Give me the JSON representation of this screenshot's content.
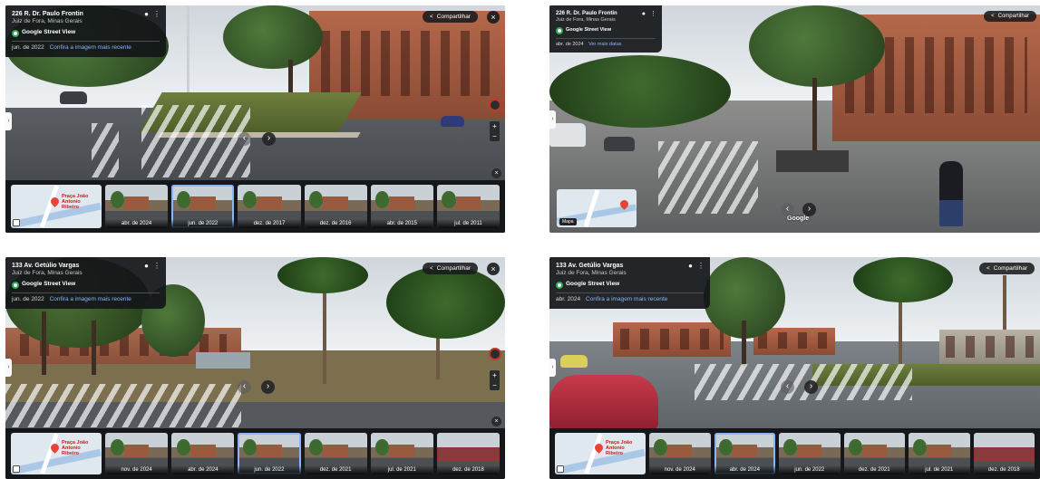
{
  "accent": "#8ab4f8",
  "panels": [
    {
      "address": "226 R. Dr. Paulo Frontin",
      "city": "Juiz de Fora, Minas Gerais",
      "source": "Google Street View",
      "capture_date": "jun. de 2022",
      "date_link": "Confira a imagem mais recente",
      "share_label": "Compartilhar",
      "map_label": "Praça João Antonio Ribeiro",
      "icons": [
        "pin-icon",
        "more-icon",
        "share-icon",
        "close-icon"
      ],
      "thumbs": [
        "abr. de 2024",
        "jun. de 2022",
        "dez. de 2017",
        "dez. de 2016",
        "abr. de 2015",
        "jul. de 2011"
      ],
      "selected_thumb": "jun. de 2022"
    },
    {
      "address": "226 R. Dr. Paulo Frontin",
      "city": "Juiz de Fora, Minas Gerais",
      "source": "Google Street View",
      "capture_date": "abr. de 2024",
      "date_link": "Ver mais datas",
      "share_label": "Compartilhar",
      "watermark": "Google",
      "map_button": "Mapa"
    },
    {
      "address": "133 Av. Getúlio Vargas",
      "city": "Juiz de Fora, Minas Gerais",
      "source": "Google Street View",
      "capture_date": "jun. de 2022",
      "date_link": "Confira a imagem mais recente",
      "share_label": "Compartilhar",
      "map_label": "Praça João Antonio Ribeiro",
      "thumbs": [
        "nov. de 2024",
        "abr. de 2024",
        "jun. de 2022",
        "dez. de 2021",
        "jul. de 2021",
        "dez. de 2018"
      ],
      "selected_thumb": "jun. de 2022"
    },
    {
      "address": "133 Av. Getúlio Vargas",
      "city": "Juiz de Fora, Minas Gerais",
      "source": "Google Street View",
      "capture_date": "abr. 2024",
      "date_link": "Confira a imagem mais recente",
      "share_label": "Compartilhar",
      "map_label": "Praça João Antonio Ribeiro",
      "thumbs": [
        "nov. de 2024",
        "abr. de 2024",
        "jun. de 2022",
        "dez. de 2021",
        "jul. de 2021",
        "dez. de 2018"
      ],
      "selected_thumb": "abr. de 2024"
    }
  ]
}
